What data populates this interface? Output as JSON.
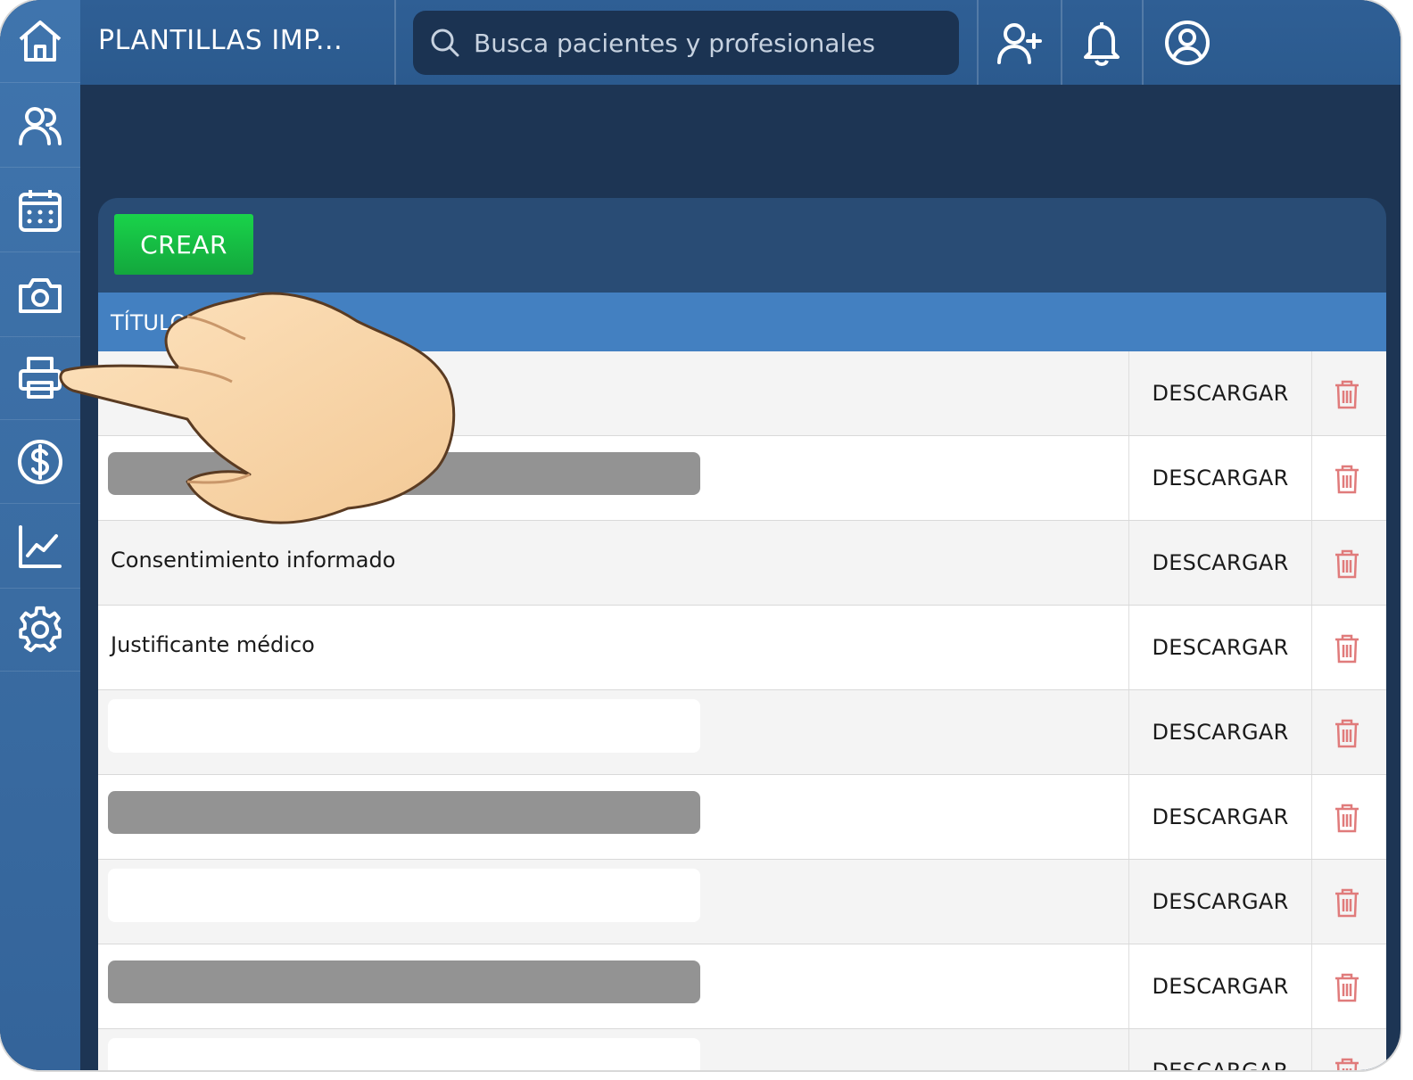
{
  "header": {
    "title": "PLANTILLAS IMP...",
    "search_placeholder": "Busca pacientes y profesionales"
  },
  "sidebar": {
    "items": [
      {
        "icon": "home-icon"
      },
      {
        "icon": "patients-icon"
      },
      {
        "icon": "calendar-icon"
      },
      {
        "icon": "camera-icon"
      },
      {
        "icon": "printer-icon"
      },
      {
        "icon": "billing-icon"
      },
      {
        "icon": "stats-icon"
      },
      {
        "icon": "settings-icon"
      }
    ]
  },
  "toolbar": {
    "create_label": "CREAR"
  },
  "table": {
    "header_title": "TÍTULO",
    "download_label": "DESCARGAR",
    "rows": [
      {
        "title": ""
      },
      {
        "title": ""
      },
      {
        "title": "Consentimiento informado"
      },
      {
        "title": "Justificante médico"
      },
      {
        "title": ""
      },
      {
        "title": ""
      },
      {
        "title": ""
      },
      {
        "title": ""
      },
      {
        "title": ""
      }
    ]
  },
  "colors": {
    "sidebar": "#3a6ca2",
    "topbar": "#2d5c91",
    "background": "#1d3554",
    "panel": "#294c75",
    "table_header": "#4380c1",
    "create_button": "#16bd44",
    "delete_icon": "#e07b7b"
  }
}
